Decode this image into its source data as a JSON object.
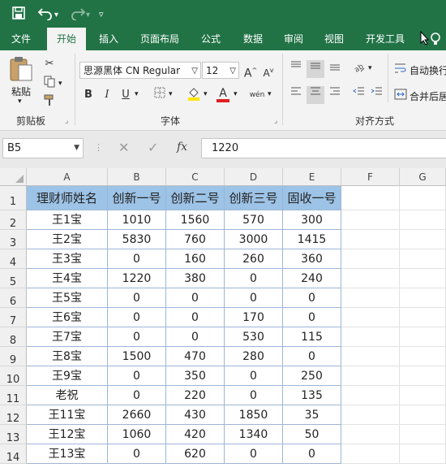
{
  "quick_access": {
    "save_icon": "save-icon",
    "undo_icon": "undo-icon",
    "redo_icon": "redo-icon",
    "customize_icon": "customize-qat-icon"
  },
  "tabs": [
    {
      "label": "文件",
      "active": false
    },
    {
      "label": "开始",
      "active": true
    },
    {
      "label": "插入",
      "active": false
    },
    {
      "label": "页面布局",
      "active": false
    },
    {
      "label": "公式",
      "active": false
    },
    {
      "label": "数据",
      "active": false
    },
    {
      "label": "审阅",
      "active": false
    },
    {
      "label": "视图",
      "active": false
    },
    {
      "label": "开发工具",
      "active": false
    }
  ],
  "ribbon": {
    "clipboard": {
      "paste_label": "粘贴",
      "group_label": "剪贴板"
    },
    "font": {
      "font_name": "思源黑体 CN Regular",
      "font_size": "12",
      "group_label": "字体",
      "bold": "B",
      "italic": "I",
      "underline": "U",
      "grow": "A",
      "shrink": "A",
      "font_color_glyph": "A",
      "phonetic": "wén"
    },
    "alignment": {
      "group_label": "对齐方式",
      "wrap_text": "自动换行",
      "merge_center": "合并后居"
    }
  },
  "formula_bar": {
    "name_box": "B5",
    "fx_label": "fx",
    "value": "1220"
  },
  "columns": [
    "A",
    "B",
    "C",
    "D",
    "E",
    "F",
    "G"
  ],
  "rows": [
    "1",
    "2",
    "3",
    "4",
    "5",
    "6",
    "7",
    "8",
    "9",
    "10",
    "11",
    "12",
    "13",
    "14"
  ],
  "table": {
    "headers": [
      "理财师姓名",
      "创新一号",
      "创新二号",
      "创新三号",
      "固收一号"
    ],
    "data": [
      [
        "王1宝",
        "1010",
        "1560",
        "570",
        "300"
      ],
      [
        "王2宝",
        "5830",
        "760",
        "3000",
        "1415"
      ],
      [
        "王3宝",
        "0",
        "160",
        "260",
        "360"
      ],
      [
        "王4宝",
        "1220",
        "380",
        "0",
        "240"
      ],
      [
        "王5宝",
        "0",
        "0",
        "0",
        "0"
      ],
      [
        "王6宝",
        "0",
        "0",
        "170",
        "0"
      ],
      [
        "王7宝",
        "0",
        "0",
        "530",
        "115"
      ],
      [
        "王8宝",
        "1500",
        "470",
        "280",
        "0"
      ],
      [
        "王9宝",
        "0",
        "350",
        "0",
        "250"
      ],
      [
        "老祝",
        "0",
        "220",
        "0",
        "135"
      ],
      [
        "王11宝",
        "2660",
        "430",
        "1850",
        "35"
      ],
      [
        "王12宝",
        "1060",
        "420",
        "1340",
        "50"
      ],
      [
        "王13宝",
        "0",
        "620",
        "0",
        "0"
      ]
    ]
  },
  "colors": {
    "brand": "#217346",
    "header_fill": "#9dc3e6",
    "font_red": "#e02020",
    "highlight_yellow": "#ffe600"
  }
}
